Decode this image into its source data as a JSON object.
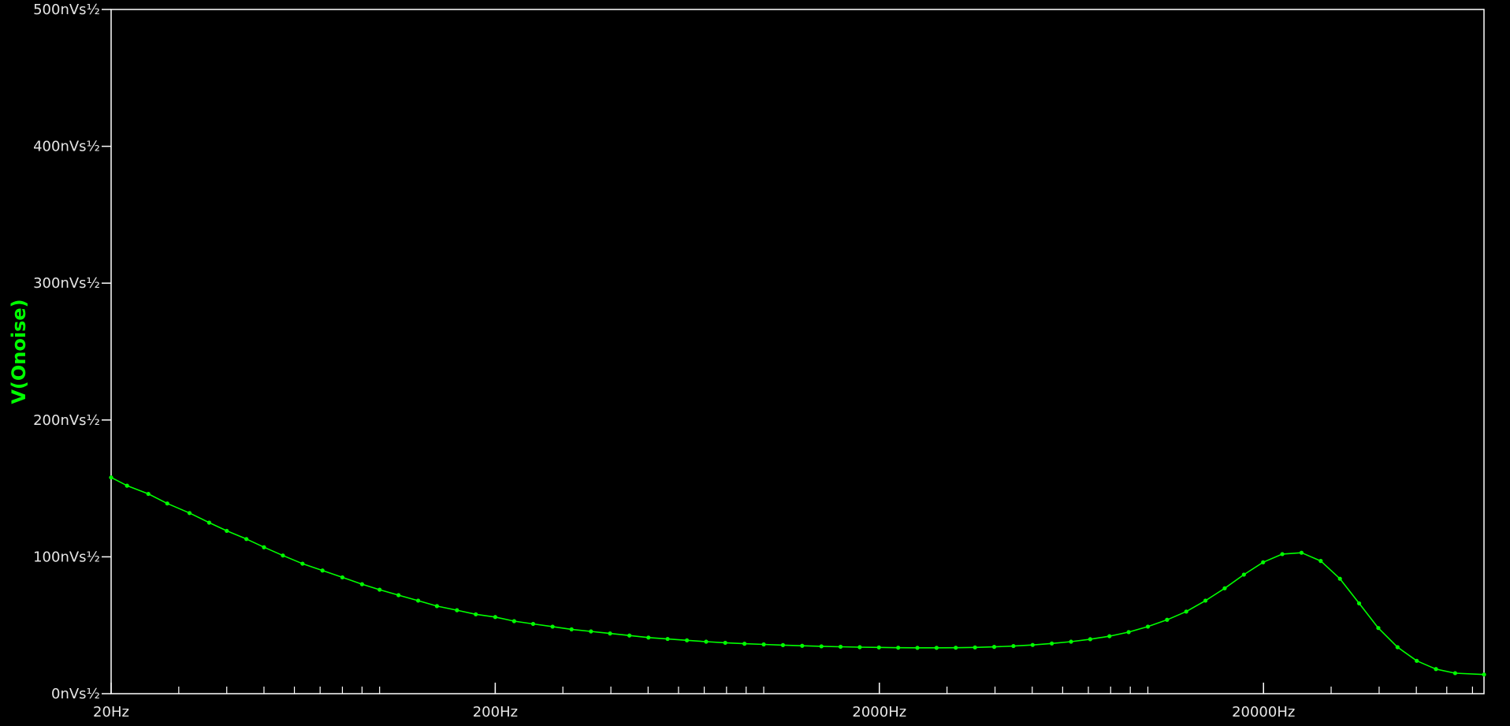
{
  "chart_data": {
    "type": "line",
    "ylabel": "V(Onoise)",
    "x_scale": "log",
    "xlim": [
      20,
      75000
    ],
    "ylim": [
      0,
      500
    ],
    "y_unit": "nVs½",
    "x_ticks": [
      "20Hz",
      "200Hz",
      "2000Hz",
      "20000Hz"
    ],
    "x_tick_values": [
      20,
      200,
      2000,
      20000
    ],
    "y_ticks": [
      "0nVs½",
      "100nVs½",
      "200nVs½",
      "300nVs½",
      "400nVs½",
      "500nVs½"
    ],
    "y_tick_values": [
      0,
      100,
      200,
      300,
      400,
      500
    ],
    "grid": false,
    "series": [
      {
        "name": "V(Onoise)",
        "color": "#00ff00",
        "x": [
          20,
          22,
          25,
          28,
          32,
          36,
          40,
          45,
          50,
          56,
          63,
          71,
          80,
          90,
          100,
          112,
          126,
          141,
          159,
          178,
          200,
          224,
          251,
          282,
          316,
          355,
          398,
          447,
          501,
          562,
          631,
          708,
          794,
          891,
          1000,
          1122,
          1259,
          1413,
          1585,
          1778,
          1995,
          2239,
          2512,
          2818,
          3162,
          3548,
          3981,
          4467,
          5012,
          5623,
          6310,
          7079,
          7943,
          8913,
          10000,
          11220,
          12589,
          14125,
          15849,
          17783,
          19953,
          22387,
          25119,
          28184,
          31623,
          35481,
          39811,
          44668,
          50119,
          56234,
          63096,
          75000
        ],
        "y": [
          158,
          152,
          146,
          139,
          132,
          125,
          119,
          113,
          107,
          101,
          95,
          90,
          85,
          80,
          76,
          72,
          68,
          64,
          61,
          58,
          56,
          53,
          51,
          49,
          47,
          45.5,
          44,
          42.5,
          41,
          40,
          39,
          38,
          37.2,
          36.5,
          36,
          35.5,
          35,
          34.6,
          34.3,
          34,
          33.8,
          33.6,
          33.5,
          33.5,
          33.6,
          33.8,
          34.2,
          34.8,
          35.6,
          36.7,
          38,
          39.8,
          42,
          45,
          49,
          54,
          60,
          68,
          77,
          87,
          96,
          102,
          103,
          97,
          84,
          66,
          48,
          34,
          24,
          18,
          15,
          14
        ]
      }
    ]
  }
}
